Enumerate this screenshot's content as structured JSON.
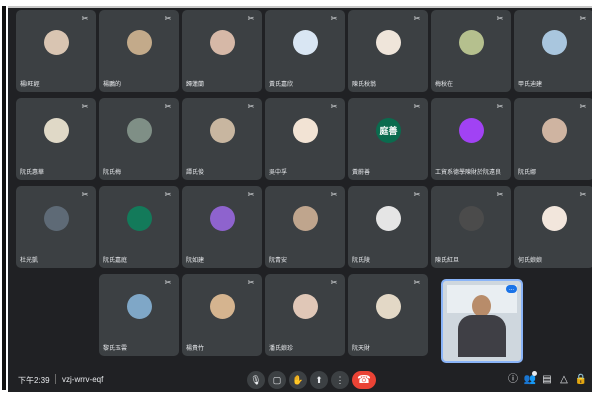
{
  "participants": [
    {
      "name": "楊I旺經",
      "avatar": "",
      "avatar_color": "#d9c5b2"
    },
    {
      "name": "楊鵬的",
      "avatar": "",
      "avatar_color": "#c3aa8a"
    },
    {
      "name": "歸蓮蘭",
      "avatar": "",
      "avatar_color": "#d6b8a7"
    },
    {
      "name": "黃氏嘉欣",
      "avatar": "",
      "avatar_color": "#d9e6f3"
    },
    {
      "name": "陳氏秋翁",
      "avatar": "",
      "avatar_color": "#efe5da"
    },
    {
      "name": "梅秋在",
      "avatar": "",
      "avatar_color": "#b5c08e"
    },
    {
      "name": "甲氏迪建",
      "avatar": "",
      "avatar_color": "#a9c6de"
    },
    {
      "name": "阮氏惠華",
      "avatar": "",
      "avatar_color": "#e0d9c7"
    },
    {
      "name": "阮氏梅",
      "avatar": "",
      "avatar_color": "#7f8f86"
    },
    {
      "name": "譚氏俊",
      "avatar": "",
      "avatar_color": "#c8b6a0"
    },
    {
      "name": "吳中孚",
      "avatar": "",
      "avatar_color": "#f2e3d4"
    },
    {
      "name": "黃蔚善",
      "avatar": "庭善",
      "avatar_color": "#0b6b4e"
    },
    {
      "name": "工貿系德學陳財於阮遠良",
      "avatar": "",
      "avatar_color": "#a142f4"
    },
    {
      "name": "阮氏娜",
      "avatar": "",
      "avatar_color": "#cfb4a1"
    },
    {
      "name": "杜光凱",
      "avatar": "",
      "avatar_color": "#5e6a76"
    },
    {
      "name": "阮氏嘉庭",
      "avatar": "",
      "avatar_color": "#137a5a"
    },
    {
      "name": "阮如建",
      "avatar": "",
      "avatar_color": "#8e63ce"
    },
    {
      "name": "阮青安",
      "avatar": "",
      "avatar_color": "#bfa58d"
    },
    {
      "name": "阮氏陵",
      "avatar": "",
      "avatar_color": "#e5e5e5"
    },
    {
      "name": "陳氏紅旦",
      "avatar": "",
      "avatar_color": "#4b4b4b"
    },
    {
      "name": "何氏娘娘",
      "avatar": "",
      "avatar_color": "#f2e6dc"
    },
    {
      "name": "黎氏玉雲",
      "avatar": "",
      "avatar_color": "#7fa7c7"
    },
    {
      "name": "楊貴竹",
      "avatar": "",
      "avatar_color": "#d5b48f"
    },
    {
      "name": "潘氏娘珍",
      "avatar": "",
      "avatar_color": "#e0c7b7"
    },
    {
      "name": "阮天財",
      "avatar": "",
      "avatar_color": "#e3d8c6"
    }
  ],
  "active_video": {
    "label": "...",
    "accent": "#8ab4f8"
  },
  "bottom_bar": {
    "time": "下午2:39",
    "meeting_code": "vzj-wrrv-eqf"
  },
  "colors": {
    "tile_bg": "#3c4043",
    "page_bg": "#202124",
    "end_call": "#ea4335"
  },
  "icons": {
    "mic": "mic-icon",
    "camera": "camera-icon",
    "raise_hand": "raise-hand-icon",
    "present": "present-icon",
    "more": "more-options-icon",
    "end_call": "end-call-icon",
    "info": "info-icon",
    "people": "people-icon",
    "chat": "chat-icon",
    "activities": "activities-icon",
    "host_controls": "host-controls-icon"
  }
}
